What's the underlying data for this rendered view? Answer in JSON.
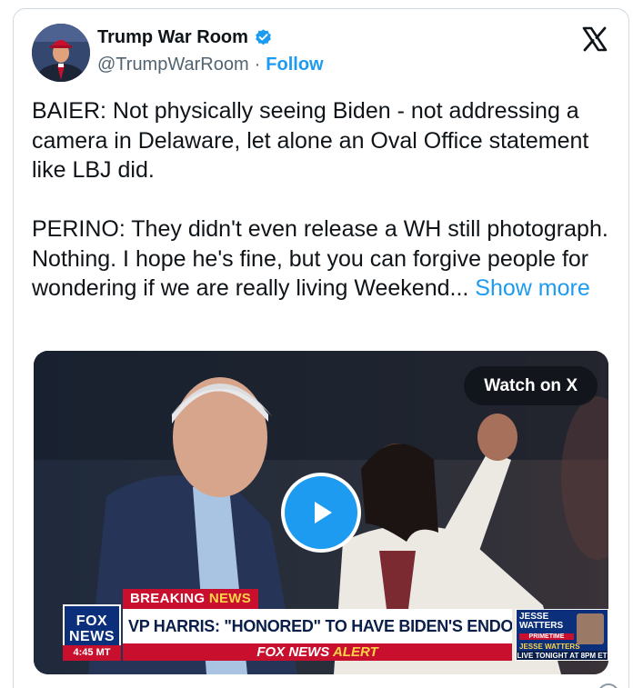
{
  "author": {
    "display_name": "Trump War Room",
    "handle": "@TrumpWarRoom",
    "separator": "·",
    "follow_label": "Follow",
    "verified": true
  },
  "tweet": {
    "text": "BAIER: Not physically seeing Biden - not addressing a camera in Delaware, let alone an Oval Office statement like LBJ did.\n\nPERINO: They didn't even release a WH still photograph. Nothing. I hope he's fine, but you can forgive people for wondering if we are really living Weekend... ",
    "show_more_label": "Show more"
  },
  "media": {
    "watch_label": "Watch on X",
    "chyron": {
      "breaking_word": "BREAKING",
      "news_word": "NEWS",
      "headline": "VP HARRIS: \"HONORED\" TO HAVE BIDEN'S ENDORSEMENT",
      "alert_prefix": "FOX NEWS",
      "alert_word": "ALERT",
      "logo_top": "FOX",
      "logo_bottom": "NEWS",
      "time": "4:45 MT",
      "promo_name": "JESSE WATTERS",
      "promo_show": "PRIMETIME",
      "promo_host": "JESSE WATTERS",
      "promo_live": "LIVE TONIGHT AT 8PM ET"
    }
  },
  "colors": {
    "accent": "#1d9bf0",
    "text": "#0f1419",
    "muted": "#536471",
    "fox_red": "#c8102e",
    "fox_blue": "#0b2f7a"
  },
  "icons": {
    "verified": "verified-badge-icon",
    "x_logo": "x-logo-icon",
    "play": "play-icon"
  }
}
